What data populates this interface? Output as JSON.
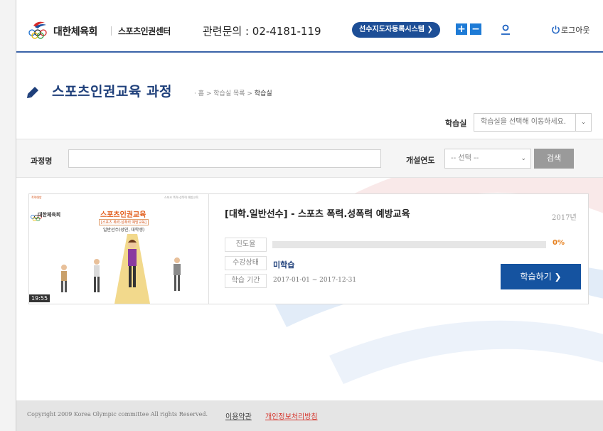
{
  "header": {
    "org_name": "대한체육회",
    "center_name": "스포츠인권센터",
    "contact": "관련문의 : 02-4181-119",
    "system_button": "선수지도자등록시스템 ❯",
    "zoom_in": "+",
    "zoom_out": "−",
    "logout": "로그아웃"
  },
  "page": {
    "title": "스포츠인권교육 과정",
    "breadcrumb": {
      "home": "· 홈 > ",
      "list": "학습실 목록 > ",
      "current": "학습실"
    }
  },
  "classroom": {
    "label": "학습실",
    "placeholder": "학습실을 선택해 이동하세요.",
    "arrow": "⌄"
  },
  "search": {
    "course_label": "과정명",
    "course_value": "",
    "year_label": "개설연도",
    "year_placeholder": "-- 선택 --",
    "button": "검색"
  },
  "course": {
    "name": "[대학.일반선수] - 스포츠 폭력.성폭력 예방교육",
    "year": "2017년",
    "progress_label": "진도율",
    "progress_value": "0%",
    "progress_fraction": 0,
    "status_label": "수강상태",
    "status_value": "미학습",
    "period_label": "학습 기간",
    "period_value": "2017-01-01 ~ 2017-12-31",
    "study_button": "학습하기 ❯",
    "thumbnail": {
      "top_left": "폭력예방",
      "top_right": "스포츠 폭력·성폭력 예방교육",
      "logo_text": "대한체육회",
      "title": "스포츠인권교육",
      "subtitle": "[스포츠 폭력·성폭력 예방교육]",
      "audience": "일반선수(성인, 대학생)",
      "duration": "19:55"
    }
  },
  "footer": {
    "copyright": "Copyright 2009 Korea Olympic committee All rights Reserved.",
    "terms": "이용약관",
    "privacy": "개인정보처리방침"
  },
  "colors": {
    "brand_blue": "#1553a0",
    "title_blue": "#1e3f7a",
    "accent_orange": "#f08a1e",
    "privacy_red": "#d6372e"
  }
}
